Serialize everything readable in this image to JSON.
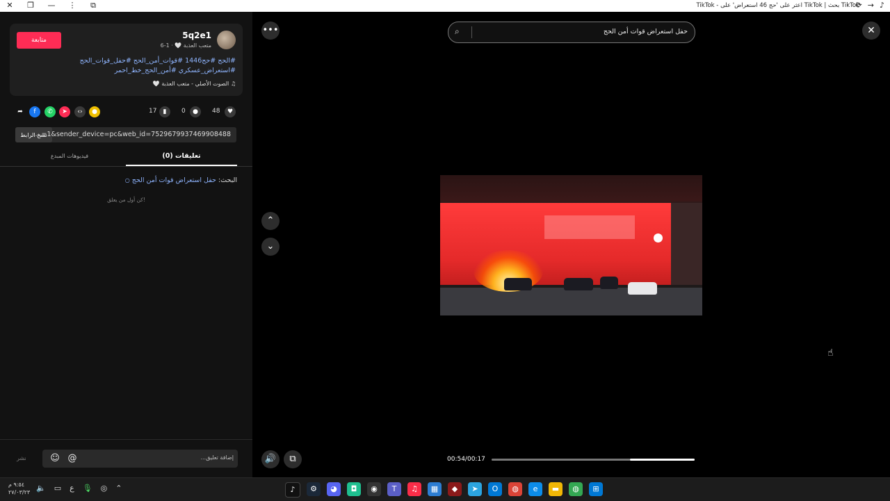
{
  "window": {
    "title": "TikTok بحث | TikTok اعثر على 'حج 46 استعراض' على - TikTok"
  },
  "profile": {
    "follow_label": "متابعة",
    "username": "5q2e1",
    "subinfo": "متعب العذبة 🤍 · 1-6",
    "hashtags": "#الحج #حج1446 #قوات_أمن_الحج #حفل_قوات_الحج #استعراض_عسكري #أمن_الحج_خط_احمر",
    "sound": "♫ الصوت الأصلي - متعب العذبة 🤍"
  },
  "stats": {
    "likes": "48",
    "comments": "0",
    "saves": "17"
  },
  "link": {
    "copy_label": "نسخ الرابط",
    "url": "...=1&sender_device=pc&web_id=7529679937469908488"
  },
  "tabs": {
    "comments": "(0) تعليقات",
    "creator_videos": "فيديوهات المبدع"
  },
  "comments": {
    "search_prefix": "البحث:",
    "search_query": "حفل استعراض قوات أمن الحج",
    "empty_text": "كن أول من يعلق!"
  },
  "composer": {
    "placeholder": "إضافة تعليق...",
    "post_label": "نشر"
  },
  "video": {
    "search_query": "حفل استعراض قوات أمن الحج",
    "timecode": "00:54/00:17",
    "progress": 0.68
  },
  "taskbar": {
    "time": "٩:٥٤ م",
    "date": "٢٧/٠٣/٢٣",
    "lang": "ع"
  },
  "icons": {
    "like": "heart-icon",
    "comment": "comment-icon",
    "save": "bookmark-icon",
    "share": "share-icon"
  },
  "colors": {
    "follow": "#fe2c55",
    "link": "#8fb5ff"
  }
}
